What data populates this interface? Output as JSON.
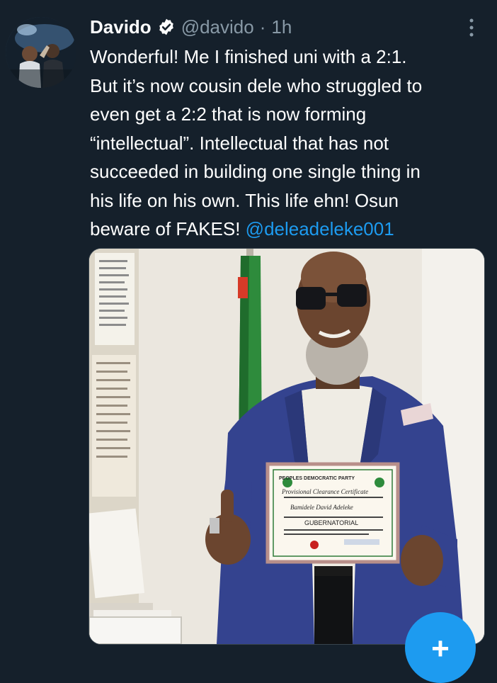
{
  "tweet": {
    "author_name": "Davido",
    "handle": "@davido",
    "separator": "·",
    "time": "1h",
    "text_lines": [
      "Wonderful! Me I finished uni with a 2:1.",
      "But it’s now cousin dele who struggled to",
      "even get a 2:2 that is now forming",
      "“intellectual”.  Intellectual that has not",
      "succeeded in building one single thing in",
      "his life on his own. This life ehn! Osun"
    ],
    "last_line_text": "beware of FAKES! ",
    "mention": "@deleadeleke001",
    "certificate": {
      "party": "PEOPLES DEMOCRATIC PARTY",
      "title": "Provisional Clearance Certificate",
      "name": "Bamidele David Adeleke",
      "office": "GUBERNATORIAL"
    }
  },
  "colors": {
    "background": "#15202b",
    "accent": "#1d9bf0",
    "muted": "#8899a6"
  },
  "icons": {
    "verified": "verified-badge-icon",
    "more": "more-options-icon",
    "compose": "compose-plus-icon"
  },
  "fab": {
    "symbol": "+"
  }
}
